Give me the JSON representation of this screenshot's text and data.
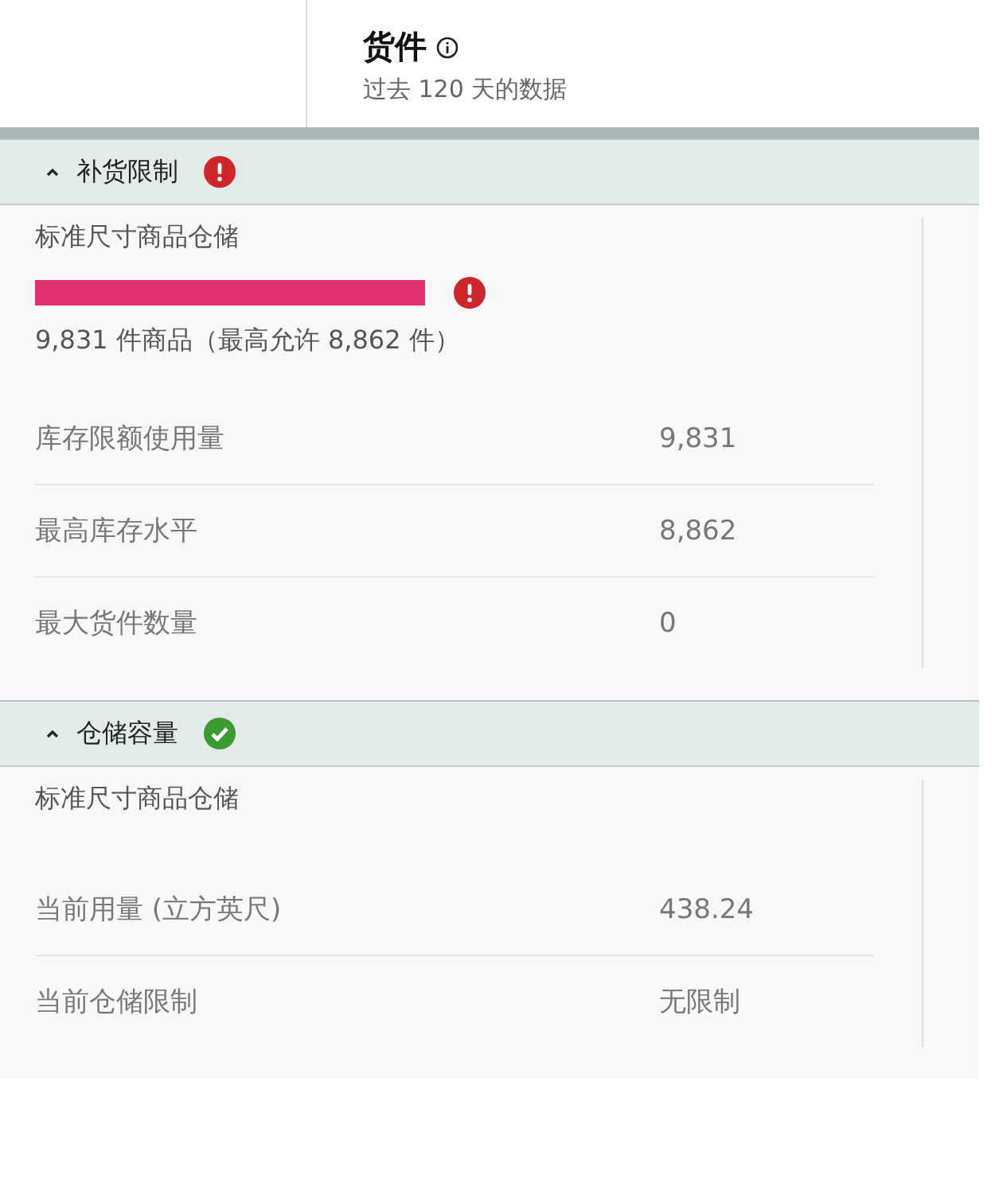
{
  "header": {
    "title": "货件",
    "subtitle": "过去 120 天的数据"
  },
  "sections": [
    {
      "title": "补货限制",
      "kind": "error",
      "expanded": true,
      "subtitle": "标准尺寸商品仓储",
      "usage": {
        "level": 1,
        "over_limit": true,
        "caption": "9,831 件商品（最高允许 8,862 件）"
      },
      "rows": [
        {
          "label": "库存限额使用量",
          "value": "9,831"
        },
        {
          "label": "最高库存水平",
          "value": "8,862"
        },
        {
          "label": "最大货件数量",
          "value": "0"
        }
      ]
    },
    {
      "title": "仓储容量",
      "kind": "ok",
      "expanded": true,
      "subtitle": "标准尺寸商品仓储",
      "rows": [
        {
          "label": "当前用量 (立方英尺)",
          "value": "438.24"
        },
        {
          "label": "当前仓储限制",
          "value": "无限制"
        }
      ]
    }
  ]
}
